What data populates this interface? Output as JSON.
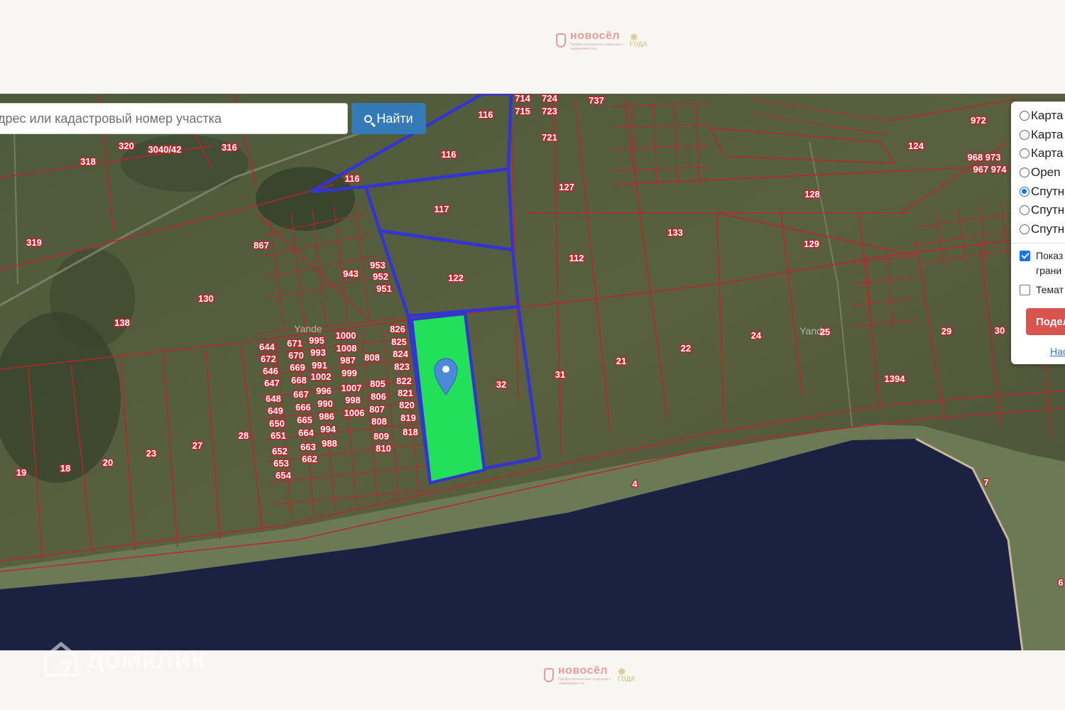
{
  "header": {
    "logo_word": "новосёл",
    "logo_tagline": "Профессиональные операции с недвижимостью",
    "logo_badge": "ГОДА"
  },
  "footer": {
    "logo_word": "новосёл",
    "logo_tagline": "Профессиональные операции с недвижимостью",
    "logo_badge": "ГОДА",
    "watermark": "домклик"
  },
  "search": {
    "placeholder": "дрес или кадастровый номер участка",
    "button_label": "Найти"
  },
  "layers_panel": {
    "options": [
      {
        "label": "Карта",
        "selected": false
      },
      {
        "label": "Карта",
        "selected": false
      },
      {
        "label": "Карта",
        "selected": false
      },
      {
        "label": "Open",
        "selected": false
      },
      {
        "label": "Спутн",
        "selected": true
      },
      {
        "label": "Спутн",
        "selected": false
      },
      {
        "label": "Спутн",
        "selected": false
      }
    ],
    "show_borders_label": "Показ грани",
    "show_borders_checked": true,
    "thematic_label": "Темат",
    "thematic_checked": false,
    "share_button": "Подел",
    "link": "Нас"
  },
  "map": {
    "watermark_yandex": "Yande",
    "colors": {
      "parcel_lines": "#c0232c",
      "selected_parcels_outline": "#3434d0",
      "highlighted_parcel": "#22e05a",
      "marker": "#4a8ad8",
      "water": "#1a2040"
    },
    "parcel_labels": [
      "116",
      "116",
      "116",
      "117",
      "122",
      "32",
      "714",
      "715",
      "724",
      "723",
      "721",
      "737",
      "127",
      "112",
      "133",
      "128",
      "129",
      "124",
      "972",
      "968 973",
      "967 974",
      "318",
      "320",
      "3040/42",
      "316",
      "319",
      "867",
      "943",
      "953",
      "952",
      "951",
      "130",
      "138",
      "826",
      "825",
      "824",
      "823",
      "822",
      "821",
      "820",
      "819",
      "818",
      "805",
      "806",
      "807",
      "808",
      "809",
      "810",
      "808",
      "1000",
      "1008",
      "987",
      "999",
      "1007",
      "998",
      "1006",
      "995",
      "993",
      "991",
      "1002",
      "996",
      "990",
      "986",
      "994",
      "988",
      "671",
      "670",
      "669",
      "668",
      "667",
      "666",
      "665",
      "664",
      "663",
      "662",
      "644",
      "672",
      "646",
      "647",
      "648",
      "649",
      "650",
      "651",
      "652",
      "653",
      "654",
      "31",
      "21",
      "22",
      "24",
      "25",
      "29",
      "30",
      "1394",
      "4",
      "7",
      "19",
      "18",
      "20",
      "23",
      "27",
      "28",
      "6"
    ]
  }
}
